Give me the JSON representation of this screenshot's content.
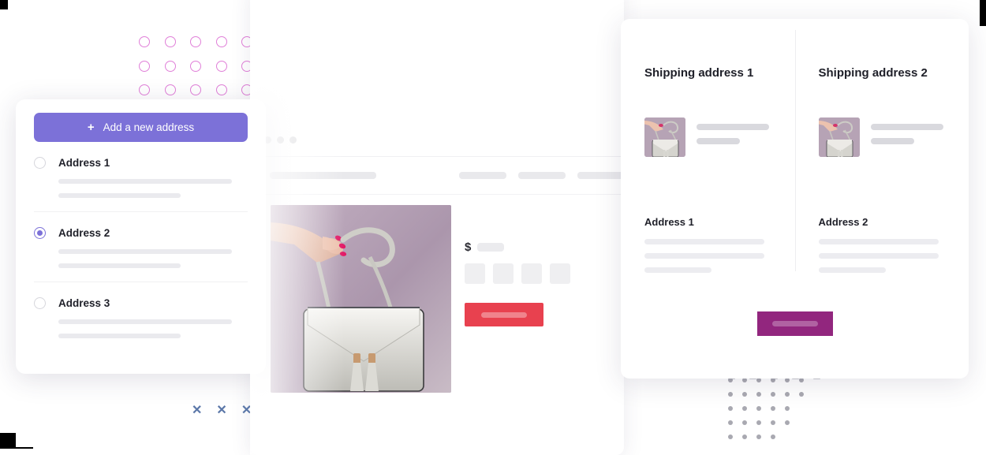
{
  "address_card": {
    "add_button": {
      "label": "Add a new address",
      "icon": "plus-icon",
      "color": "#7c71d8"
    },
    "items": [
      {
        "label": "Address 1",
        "selected": false
      },
      {
        "label": "Address 2",
        "selected": true
      },
      {
        "label": "Address 3",
        "selected": false
      }
    ]
  },
  "shipping_card": {
    "columns": [
      {
        "title": "Shipping address 1",
        "address_label": "Address 1"
      },
      {
        "title": "Shipping address 2",
        "address_label": "Address 2"
      }
    ],
    "cta": {
      "label": "",
      "color": "#92267e"
    }
  },
  "product_window": {
    "price_symbol": "$",
    "buy_button": {
      "label": "",
      "color": "#e8414f"
    },
    "swatch_count": 4,
    "nav_item_count": 3,
    "window_dot_count": 3
  },
  "decorations": {
    "circle_grid": {
      "columns": 8,
      "rows": 5,
      "color": "#e07fd8"
    },
    "triangles": {
      "count": 5,
      "color": "#8c8c96"
    },
    "x_marks": {
      "glyph": "✕",
      "count": 3,
      "color": "#5b77a8"
    },
    "dot_grid": {
      "columns": 6,
      "rows": 5,
      "color": "#a9a9b1"
    }
  },
  "palette": {
    "purple": "#7c71d8",
    "magenta": "#92267e",
    "red": "#e8414f",
    "pink_outline": "#e07fd8",
    "skeleton_gray": "#e9e9ec"
  }
}
